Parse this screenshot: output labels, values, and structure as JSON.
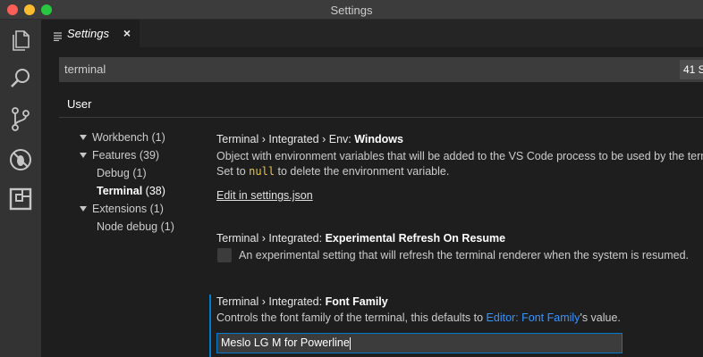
{
  "window": {
    "title": "Settings"
  },
  "editor_tab": {
    "label": "Settings",
    "close_glyph": "×"
  },
  "activity_bar": [
    "explorer-icon",
    "search-icon",
    "source-control-icon",
    "debug-icon",
    "extensions-icon"
  ],
  "search": {
    "value": "terminal",
    "result_count": "41 S"
  },
  "scope_tabs": [
    {
      "label": "User"
    }
  ],
  "toc": [
    {
      "label": "Workbench",
      "count": "(1)",
      "expandable": true
    },
    {
      "label": "Features",
      "count": "(39)",
      "expandable": true
    },
    {
      "label": "Debug",
      "count": "(1)",
      "expandable": false
    },
    {
      "label": "Terminal",
      "count": "(38)",
      "expandable": false,
      "active": true
    },
    {
      "label": "Extensions",
      "count": "(1)",
      "expandable": true
    },
    {
      "label": "Node debug",
      "count": "(1)",
      "expandable": false
    }
  ],
  "settings": {
    "env_windows": {
      "category": "Terminal › Integrated › Env: ",
      "name": "Windows",
      "desc_line1": "Object with environment variables that will be added to the VS Code process to be used by the term",
      "desc_pre": "Set to ",
      "desc_code": "null",
      "desc_post": " to delete the environment variable.",
      "edit_link": "Edit in settings.json"
    },
    "refresh_on_resume": {
      "category": "Terminal › Integrated: ",
      "name": "Experimental Refresh On Resume",
      "desc": "An experimental setting that will refresh the terminal renderer when the system is resumed.",
      "checked": false
    },
    "font_family": {
      "category": "Terminal › Integrated: ",
      "name": "Font Family",
      "desc_pre": "Controls the font family of the terminal, this defaults to ",
      "desc_link": "Editor: Font Family",
      "desc_post": "'s value.",
      "value": "Meslo LG M for Powerline"
    }
  },
  "colors": {
    "accent": "#007acc",
    "link": "#3794ff",
    "code": "#e7c547"
  }
}
